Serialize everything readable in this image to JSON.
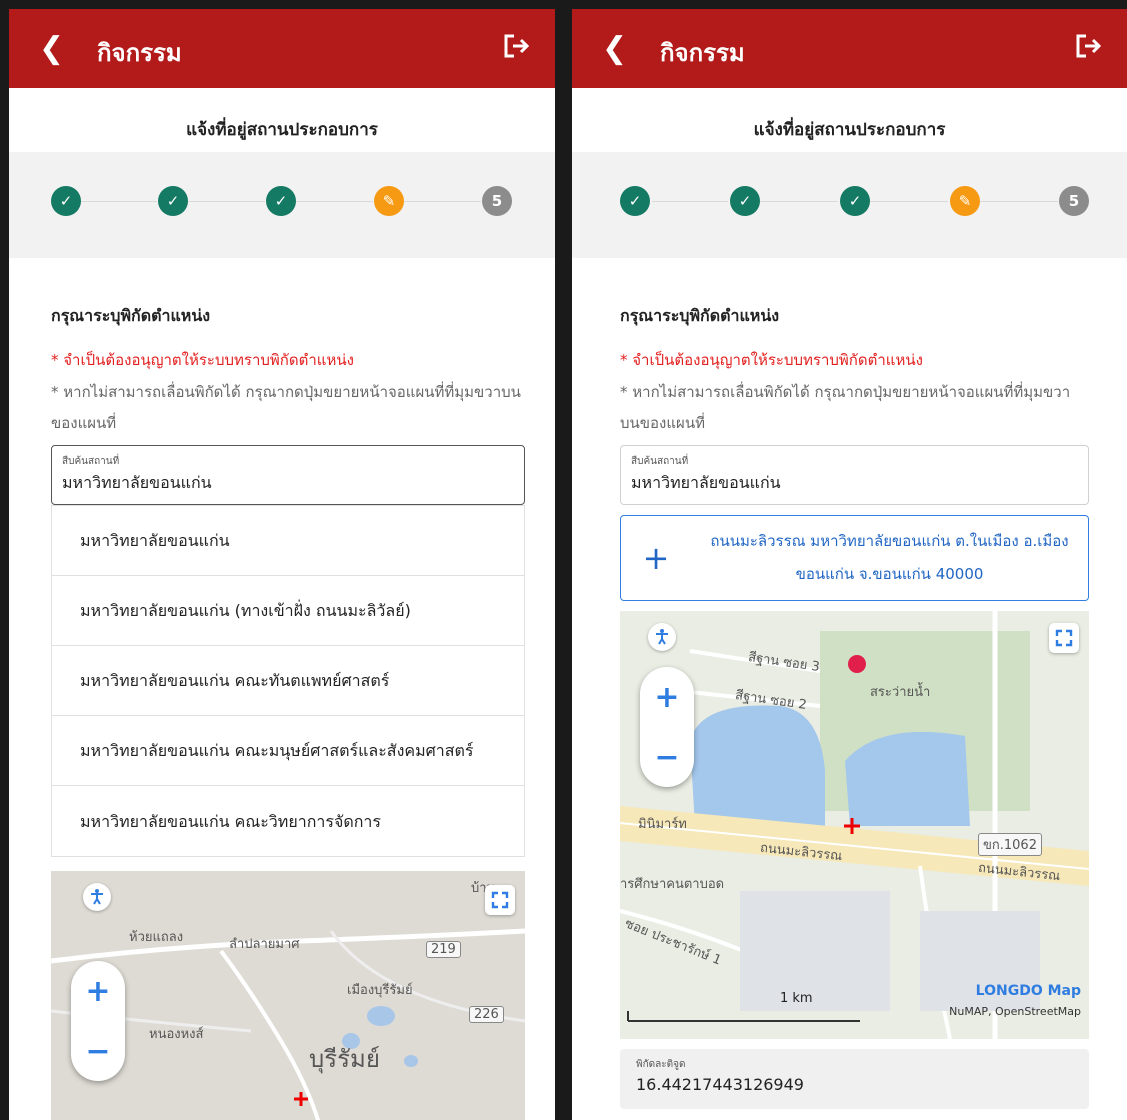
{
  "header": {
    "title": "กิจกรรม"
  },
  "stepper": {
    "title": "แจ้งที่อยู่สถานประกอบการ",
    "step5_label": "5"
  },
  "form": {
    "section_title": "กรุณาระบุพิกัดตำแหน่ง",
    "required_note": "* จำเป็นต้องอนุญาตให้ระบบทราบพิกัดตำแหน่ง",
    "hint_note": "* หากไม่สามารถเลื่อนพิกัดได้ กรุณากดปุ่มขยายหน้าจอแผนที่ที่มุมขวาบนของแผนที่",
    "search_label": "สืบค้นสถานที่",
    "search_value": "มหาวิทยาลัยขอนแก่น"
  },
  "suggestions": [
    "มหาวิทยาลัยขอนแก่น",
    "มหาวิทยาลัยขอนแก่น (ทางเข้าฝั่ง ถนนมะลิวัลย์)",
    "มหาวิทยาลัยขอนแก่น คณะทันตแพทย์ศาสตร์",
    "มหาวิทยาลัยขอนแก่น คณะมนุษย์ศาสตร์และสังคมศาสตร์",
    "มหาวิทยาลัยขอนแก่น คณะวิทยาการจัดการ"
  ],
  "address_button": {
    "text": "ถนนมะลิวรรณ มหาวิทยาลัยขอนแก่น ต.ในเมือง อ.เมืองขอนแก่น จ.ขอนแก่น 40000"
  },
  "map1": {
    "labels": {
      "huai_laeng": "ห้วยแถลง",
      "lam_plai_mat": "ลำปลายมาศ",
      "rd219": "219",
      "mueang_buriram": "เมืองบุรีรัมย์",
      "rd226": "226",
      "nong_hong": "หนองหงส์",
      "buriram": "บุรีรัมย์",
      "ban": "บ้าน"
    }
  },
  "map2": {
    "labels": {
      "sithan3": "สีฐาน ซอย 3",
      "sithan2": "สีฐาน ซอย 2",
      "sa_wai_nam": "สระว่ายน้ำ",
      "minimart": "มินิมาร์ท",
      "rd1062": "ขก.1062",
      "maliwan1": "ถนนมะลิวรรณ",
      "maliwan2": "ถนนมะลิวรรณ",
      "blind_school": "ารศึกษาคนตาบอด",
      "prachasamakkhi": "ซอย ประชารักษ์ 1",
      "scale": "1 km",
      "logo": "LONGDO Map",
      "attribution": "NuMAP, OpenStreetMap"
    }
  },
  "coordinate": {
    "label": "พิกัดละติจูด",
    "value": "16.44217443126949"
  },
  "colors": {
    "header": "#b31b1b",
    "step_done": "#157a63",
    "step_current": "#f59a12",
    "step_todo": "#8c8c8c",
    "required": "#e22020",
    "link": "#2166c4"
  }
}
